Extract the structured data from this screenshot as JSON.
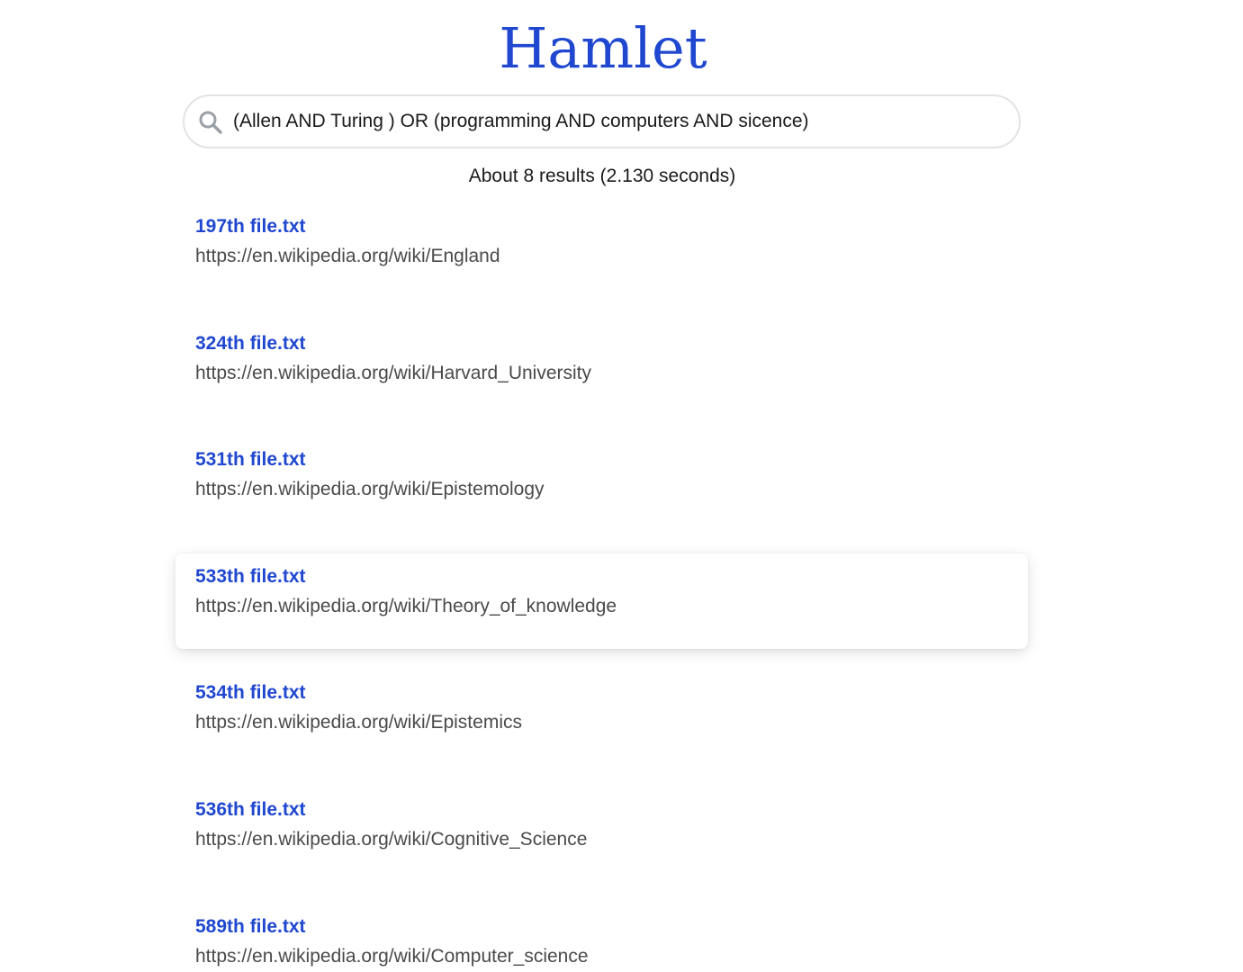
{
  "app": {
    "logo": "Hamlet"
  },
  "search": {
    "query": "(Allen AND Turing ) OR (programming AND computers AND sicence)",
    "icon": "search-icon"
  },
  "stats": "About 8 results (2.130 seconds)",
  "results": [
    {
      "title": "197th file.txt",
      "url": "https://en.wikipedia.org/wiki/England"
    },
    {
      "title": "324th file.txt",
      "url": "https://en.wikipedia.org/wiki/Harvard_University"
    },
    {
      "title": "531th file.txt",
      "url": "https://en.wikipedia.org/wiki/Epistemology"
    },
    {
      "title": "533th file.txt",
      "url": "https://en.wikipedia.org/wiki/Theory_of_knowledge"
    },
    {
      "title": "534th file.txt",
      "url": "https://en.wikipedia.org/wiki/Epistemics"
    },
    {
      "title": "536th file.txt",
      "url": "https://en.wikipedia.org/wiki/Cognitive_Science"
    },
    {
      "title": "589th file.txt",
      "url": "https://en.wikipedia.org/wiki/Computer_science"
    }
  ],
  "colors": {
    "brand": "#1f47cf",
    "url_text": "#4a4a4a",
    "search_border": "#e3e3e3"
  }
}
